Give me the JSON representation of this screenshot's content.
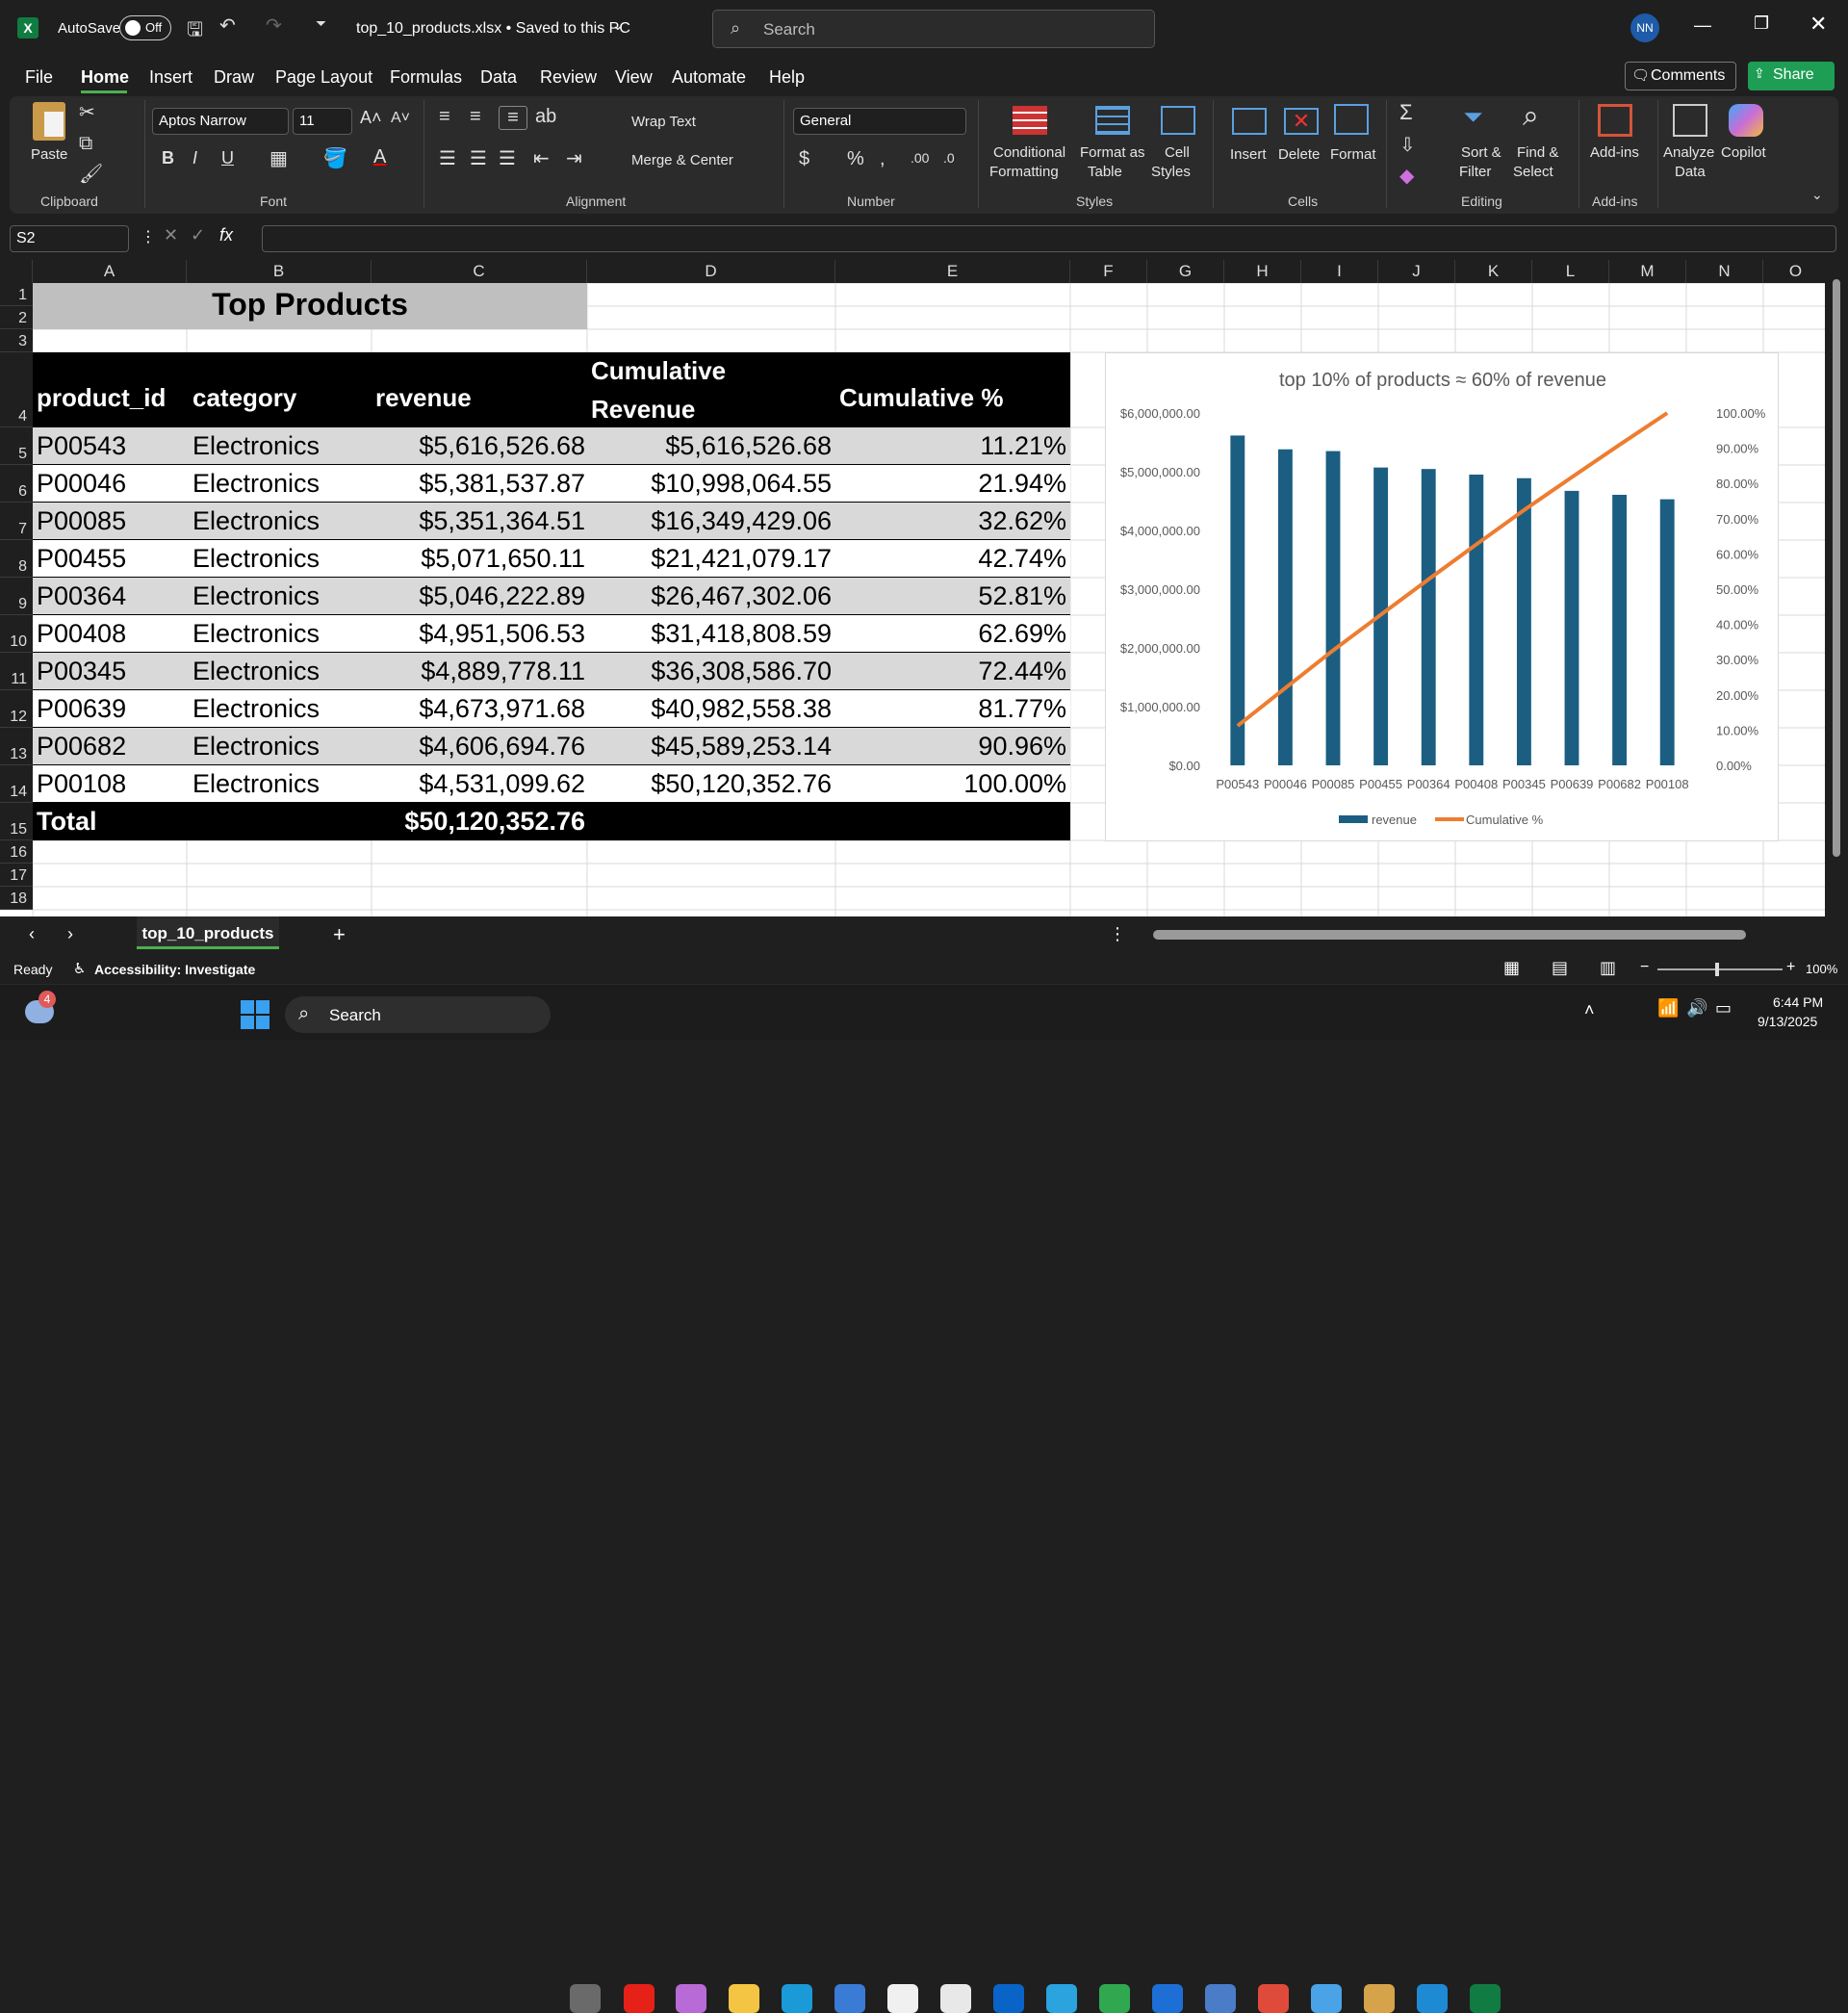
{
  "title": {
    "autosave": "AutoSave",
    "autosave_state": "Off",
    "filename": "top_10_products.xlsx • Saved to this PC",
    "search_placeholder": "Search",
    "avatar": "NN"
  },
  "menu": [
    "File",
    "Home",
    "Insert",
    "Draw",
    "Page Layout",
    "Formulas",
    "Data",
    "Review",
    "View",
    "Automate",
    "Help"
  ],
  "comments": "Comments",
  "share": "Share",
  "ribbon": {
    "paste": "Paste",
    "clipboard": "Clipboard",
    "font_name": "Aptos Narrow",
    "font_size": "11",
    "font": "Font",
    "wrap": "Wrap Text",
    "merge": "Merge & Center",
    "alignment": "Alignment",
    "numfmt": "General",
    "number": "Number",
    "cond1": "Conditional",
    "cond2": "Formatting",
    "fmt1": "Format as",
    "fmt2": "Table",
    "cs1": "Cell",
    "cs2": "Styles",
    "styles": "Styles",
    "insert": "Insert",
    "delete": "Delete",
    "format": "Format",
    "cells": "Cells",
    "sort1": "Sort &",
    "sort2": "Filter",
    "find1": "Find &",
    "find2": "Select",
    "editing": "Editing",
    "addins": "Add-ins",
    "addins_grp": "Add-ins",
    "analyze1": "Analyze",
    "analyze2": "Data",
    "copilot": "Copilot"
  },
  "namebox": "S2",
  "columns": [
    "A",
    "B",
    "C",
    "D",
    "E",
    "F",
    "G",
    "H",
    "I",
    "J",
    "K",
    "L",
    "M",
    "N",
    "O"
  ],
  "rows": [
    "1",
    "2",
    "3",
    "4",
    "5",
    "6",
    "7",
    "8",
    "9",
    "10",
    "11",
    "12",
    "13",
    "14",
    "15",
    "16",
    "17",
    "18"
  ],
  "sheet": {
    "title": "Top Products",
    "headers": [
      "product_id",
      "category",
      "revenue",
      "Cumulative",
      "Revenue",
      "Cumulative %"
    ],
    "data": [
      [
        "P00543",
        "Electronics",
        "$5,616,526.68",
        "$5,616,526.68",
        "11.21%"
      ],
      [
        "P00046",
        "Electronics",
        "$5,381,537.87",
        "$10,998,064.55",
        "21.94%"
      ],
      [
        "P00085",
        "Electronics",
        "$5,351,364.51",
        "$16,349,429.06",
        "32.62%"
      ],
      [
        "P00455",
        "Electronics",
        "$5,071,650.11",
        "$21,421,079.17",
        "42.74%"
      ],
      [
        "P00364",
        "Electronics",
        "$5,046,222.89",
        "$26,467,302.06",
        "52.81%"
      ],
      [
        "P00408",
        "Electronics",
        "$4,951,506.53",
        "$31,418,808.59",
        "62.69%"
      ],
      [
        "P00345",
        "Electronics",
        "$4,889,778.11",
        "$36,308,586.70",
        "72.44%"
      ],
      [
        "P00639",
        "Electronics",
        "$4,673,971.68",
        "$40,982,558.38",
        "81.77%"
      ],
      [
        "P00682",
        "Electronics",
        "$4,606,694.76",
        "$45,589,253.14",
        "90.96%"
      ],
      [
        "P00108",
        "Electronics",
        "$4,531,099.62",
        "$50,120,352.76",
        "100.00%"
      ]
    ],
    "total_label": "Total",
    "total_value": "$50,120,352.76"
  },
  "chart_data": {
    "type": "bar",
    "title": "top 10% of products ≈ 60% of revenue",
    "categories": [
      "P00543",
      "P00046",
      "P00085",
      "P00455",
      "P00364",
      "P00408",
      "P00345",
      "P00639",
      "P00682",
      "P00108"
    ],
    "series": [
      {
        "name": "revenue",
        "type": "bar",
        "axis": "left",
        "color": "#1b5e82",
        "values": [
          5616526.68,
          5381537.87,
          5351364.51,
          5071650.11,
          5046222.89,
          4951506.53,
          4889778.11,
          4673971.68,
          4606694.76,
          4531099.62
        ]
      },
      {
        "name": "Cumulative %",
        "type": "line",
        "axis": "right",
        "color": "#ed7d31",
        "values": [
          11.21,
          21.94,
          32.62,
          42.74,
          52.81,
          62.69,
          72.44,
          81.77,
          90.96,
          100.0
        ]
      }
    ],
    "ylim": [
      0,
      6000000
    ],
    "y2lim": [
      0,
      100
    ],
    "yticks": [
      "$0.00",
      "$1,000,000.00",
      "$2,000,000.00",
      "$3,000,000.00",
      "$4,000,000.00",
      "$5,000,000.00",
      "$6,000,000.00"
    ],
    "y2ticks": [
      "0.00%",
      "10.00%",
      "20.00%",
      "30.00%",
      "40.00%",
      "50.00%",
      "60.00%",
      "70.00%",
      "80.00%",
      "90.00%",
      "100.00%"
    ],
    "legend": "bottom",
    "grid": false
  },
  "tabs": {
    "sheet": "top_10_products"
  },
  "status": {
    "ready": "Ready",
    "accessibility": "Accessibility: Investigate",
    "zoom": "100%"
  },
  "taskbar": {
    "search": "Search",
    "time": "6:44 PM",
    "date": "9/13/2025",
    "badge": "4"
  }
}
